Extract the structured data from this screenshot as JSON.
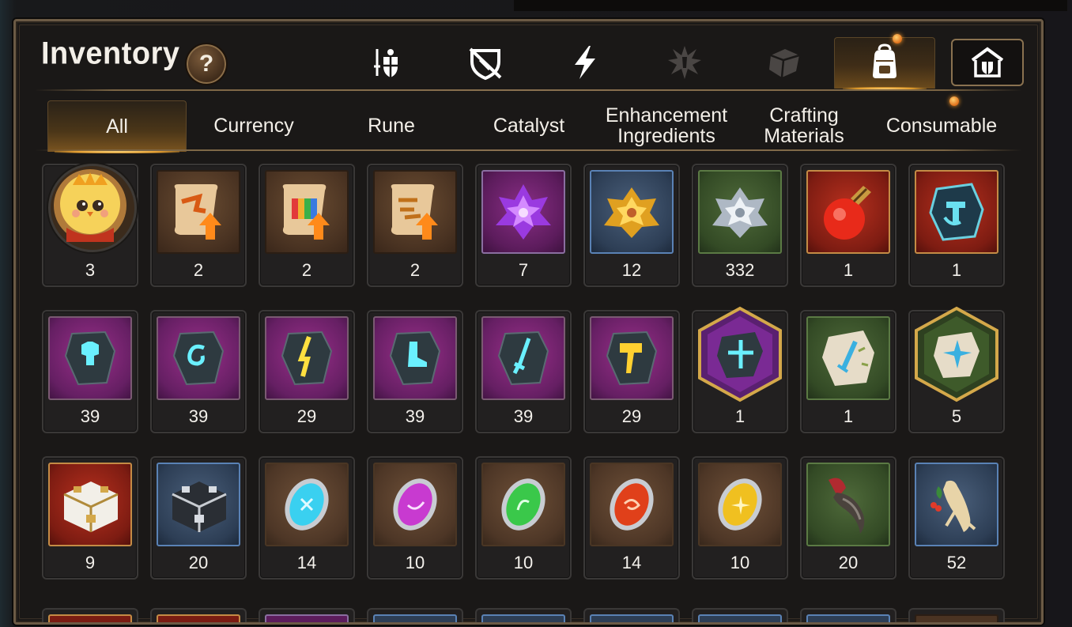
{
  "window": {
    "title": "Inventory"
  },
  "help_button": {
    "label": "?"
  },
  "category_tabs": [
    {
      "icon": "sword-shield-icon",
      "active": false
    },
    {
      "icon": "broken-shield-icon",
      "active": false
    },
    {
      "icon": "lightning-icon",
      "active": false
    },
    {
      "icon": "burst-icon",
      "active": false
    },
    {
      "icon": "cube-icon",
      "active": false
    },
    {
      "icon": "backpack-icon",
      "active": true
    },
    {
      "icon": "house-shield-icon",
      "active": false
    }
  ],
  "sub_tabs": [
    {
      "label": "All",
      "active": true
    },
    {
      "label": "Currency",
      "active": false
    },
    {
      "label": "Rune",
      "active": false
    },
    {
      "label": "Catalyst",
      "active": false
    },
    {
      "label": "Enhancement\nIngredients",
      "active": false
    },
    {
      "label": "Crafting\nMaterials",
      "active": false
    },
    {
      "label": "Consumable",
      "active": false
    }
  ],
  "items": [
    {
      "icon": "chick-portrait-icon",
      "count": "3",
      "frame": "circle"
    },
    {
      "icon": "scroll-upgrade-icon",
      "count": "2",
      "frame": "brown"
    },
    {
      "icon": "scroll-rainbow-icon",
      "count": "2",
      "frame": "brown"
    },
    {
      "icon": "scroll-upgrade-icon",
      "count": "2",
      "frame": "brown"
    },
    {
      "icon": "purple-crystal-flower-icon",
      "count": "7",
      "frame": "purple"
    },
    {
      "icon": "gold-crystal-flower-icon",
      "count": "12",
      "frame": "blue"
    },
    {
      "icon": "silver-crystal-flower-icon",
      "count": "332",
      "frame": "green"
    },
    {
      "icon": "red-potion-icon",
      "count": "1",
      "frame": "red"
    },
    {
      "icon": "hammer-rune-stone-icon",
      "count": "1",
      "frame": "red"
    },
    {
      "icon": "armor-rune-icon",
      "count": "39",
      "frame": "purple2"
    },
    {
      "icon": "spiral-rune-icon",
      "count": "39",
      "frame": "purple2"
    },
    {
      "icon": "bolt-rune-icon",
      "count": "29",
      "frame": "purple2"
    },
    {
      "icon": "boot-rune-icon",
      "count": "39",
      "frame": "purple2"
    },
    {
      "icon": "sword-rune-icon",
      "count": "39",
      "frame": "purple2"
    },
    {
      "icon": "hammer-rune-icon",
      "count": "29",
      "frame": "purple2"
    },
    {
      "icon": "star-rune-hex-icon",
      "count": "1",
      "frame": "hex-purple"
    },
    {
      "icon": "blade-stone-icon",
      "count": "1",
      "frame": "green"
    },
    {
      "icon": "star-stone-hex-icon",
      "count": "5",
      "frame": "hex-green"
    },
    {
      "icon": "white-chest-icon",
      "count": "9",
      "frame": "red"
    },
    {
      "icon": "steel-chest-icon",
      "count": "20",
      "frame": "blue"
    },
    {
      "icon": "blue-gem-icon",
      "count": "14",
      "frame": "brown2"
    },
    {
      "icon": "purple-gem-icon",
      "count": "10",
      "frame": "brown2"
    },
    {
      "icon": "green-gem-icon",
      "count": "10",
      "frame": "brown2"
    },
    {
      "icon": "red-gem-icon",
      "count": "14",
      "frame": "brown2"
    },
    {
      "icon": "yellow-gem-icon",
      "count": "10",
      "frame": "brown2"
    },
    {
      "icon": "claw-icon",
      "count": "20",
      "frame": "green"
    },
    {
      "icon": "ginseng-root-icon",
      "count": "52",
      "frame": "blue"
    }
  ],
  "colors": {
    "panel_bg": "#1a1817",
    "gold_border": "#6b5a45",
    "accent_glow": "#e8a030",
    "text": "#f3efe8"
  }
}
